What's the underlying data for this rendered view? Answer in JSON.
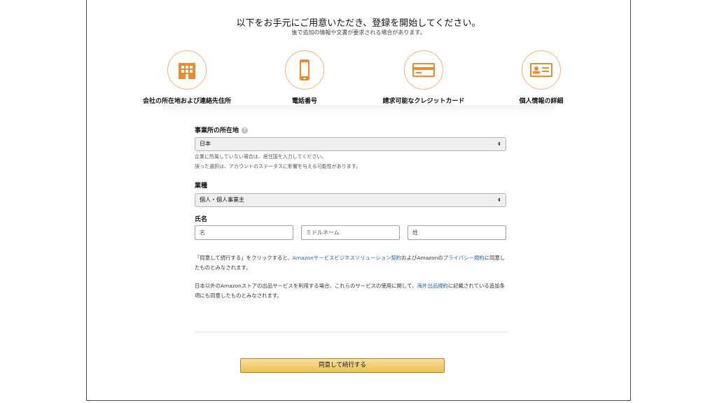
{
  "header": {
    "title": "以下をお手元にご用意いただき、登録を開始してください。",
    "subtitle": "後で追加の情報や文書が要求される場合があります。"
  },
  "steps": [
    {
      "label": "会社の所在地および連絡先住所",
      "icon": "building-icon"
    },
    {
      "label": "電話番号",
      "icon": "smartphone-icon"
    },
    {
      "label": "請求可能なクレジットカード",
      "icon": "credit-card-icon"
    },
    {
      "label": "個人情報の詳細",
      "icon": "id-card-icon"
    }
  ],
  "business_location": {
    "label": "事業所の所在地",
    "selected": "日本",
    "note1": "企業に所属していない場合は、居住国を入力してください。",
    "note2": "誤った選択は、アカウントのステータスに影響を与える可能性があります。"
  },
  "business_type": {
    "label": "業種",
    "selected": "個人・個人事業主"
  },
  "name": {
    "label": "氏名",
    "first_placeholder": "名",
    "middle_placeholder": "ミドルネーム",
    "last_placeholder": "姓"
  },
  "agreement": {
    "p1_a": "「同意して続行する」をクリックすると、",
    "p1_link1": "Amazonサービスビジネスソリューション契約",
    "p1_b": "およびAmazonの",
    "p1_link2": "プライバシー規約",
    "p1_c": "に同意したものとみなされます。",
    "p2_a": "日本以外のAmazonストアの出品サービスを利用する場合、これらのサービスの使用に関して、",
    "p2_link": "海外出品規約",
    "p2_b": "に記載されている追加条項にも同意したものとみなされます。"
  },
  "submit_label": "同意して続行する",
  "colors": {
    "accent_orange": "#f08a24",
    "link_blue": "#1a65a8",
    "button_yellow": "#f0c14b"
  }
}
